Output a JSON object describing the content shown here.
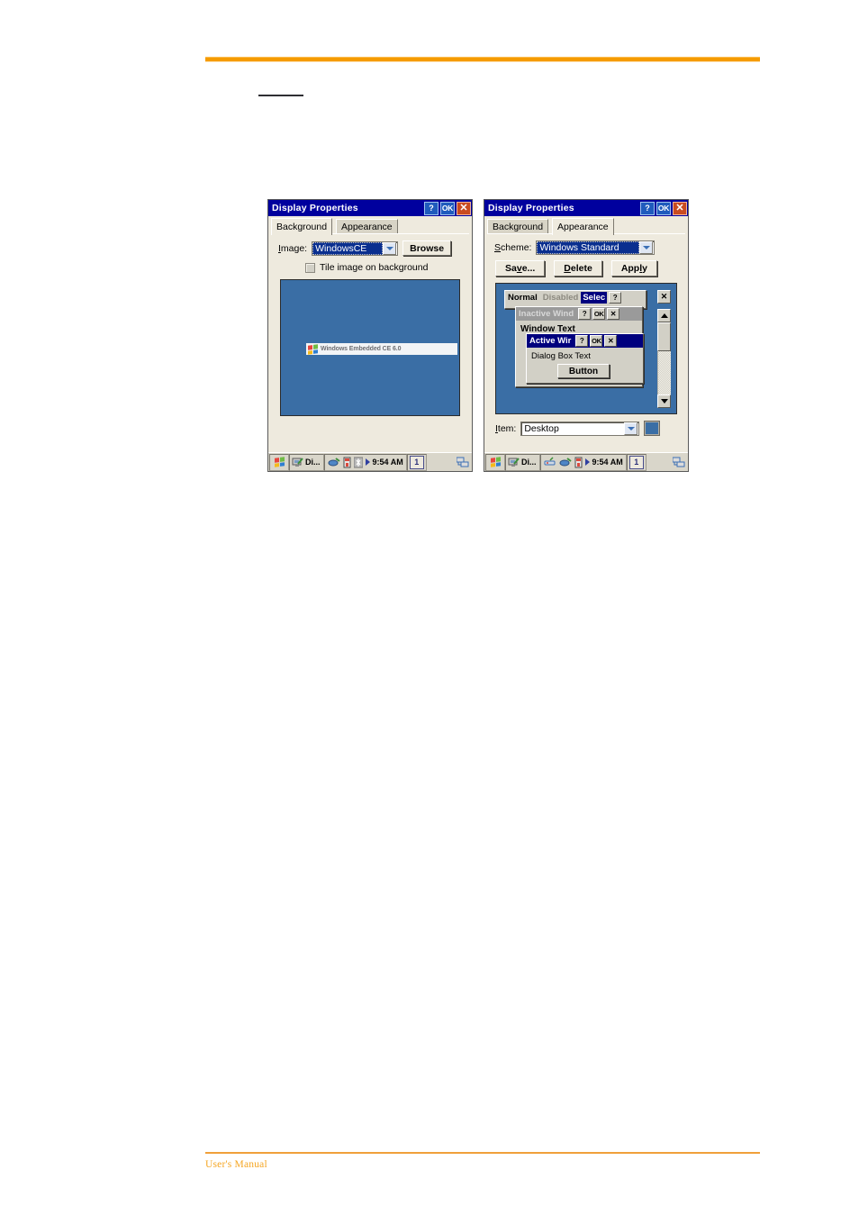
{
  "document": {
    "footer_label": "User's Manual",
    "rule_color": "#f59b00",
    "footer_color": "#f5a623"
  },
  "windows": [
    {
      "id": "background",
      "title": "Display Properties",
      "titlebar_buttons": [
        {
          "name": "help-button",
          "label": "?"
        },
        {
          "name": "ok-button",
          "label": "OK"
        },
        {
          "name": "close-button",
          "label": "✕"
        }
      ],
      "tabs": [
        {
          "label": "Background",
          "active": true
        },
        {
          "label": "Appearance",
          "active": false
        }
      ],
      "image_field": {
        "label_pre": "I",
        "label_key": "",
        "label": "Image:",
        "value": "WindowsCE",
        "browse_label": "Browse"
      },
      "tile_checkbox": {
        "label": "Tile image on background",
        "checked": false
      },
      "preview": {
        "bg_color": "#3a6ea5",
        "logo_text": "Windows Embedded CE 6.0"
      },
      "taskbar": {
        "task_label": "Di...",
        "clock": "9:54 AM",
        "keyboard_label": "1",
        "tray_icons": [
          "volume-icon",
          "battery-icon",
          "bluetooth-icon"
        ]
      }
    },
    {
      "id": "appearance",
      "title": "Display Properties",
      "titlebar_buttons": [
        {
          "name": "help-button",
          "label": "?"
        },
        {
          "name": "ok-button",
          "label": "OK"
        },
        {
          "name": "close-button",
          "label": "✕"
        }
      ],
      "tabs": [
        {
          "label": "Background",
          "active": false
        },
        {
          "label": "Appearance",
          "active": true
        }
      ],
      "scheme_field": {
        "label": "Scheme:",
        "value": "Windows Standard"
      },
      "buttons": [
        {
          "name": "save-button",
          "label": "Save..."
        },
        {
          "name": "delete-button",
          "label": "Delete"
        },
        {
          "name": "apply-button",
          "label": "Apply"
        }
      ],
      "preview": {
        "bg_color": "#3a6ea5",
        "window_normal": {
          "segments": [
            "Normal",
            "Disabled",
            "Selec"
          ],
          "buttons": [
            "?",
            "✕"
          ]
        },
        "window_inactive": {
          "title": "Inactive Wind",
          "buttons": [
            "?",
            "OK",
            "✕"
          ],
          "body_text": "Window Text"
        },
        "window_active": {
          "title": "Active Wir",
          "buttons": [
            "?",
            "OK",
            "✕"
          ],
          "body_text": "Dialog Box Text",
          "button_label": "Button"
        },
        "scrollbar": {
          "close_label": "✕",
          "up_label": "up-arrow",
          "down_label": "down-arrow"
        }
      },
      "item_field": {
        "label": "Item:",
        "value": "Desktop",
        "color": "#3a6ea5"
      },
      "taskbar": {
        "task_label": "Di...",
        "clock": "9:54 AM",
        "keyboard_label": "1",
        "tray_icons": [
          "network-icon",
          "volume-icon",
          "battery-icon"
        ]
      }
    }
  ]
}
